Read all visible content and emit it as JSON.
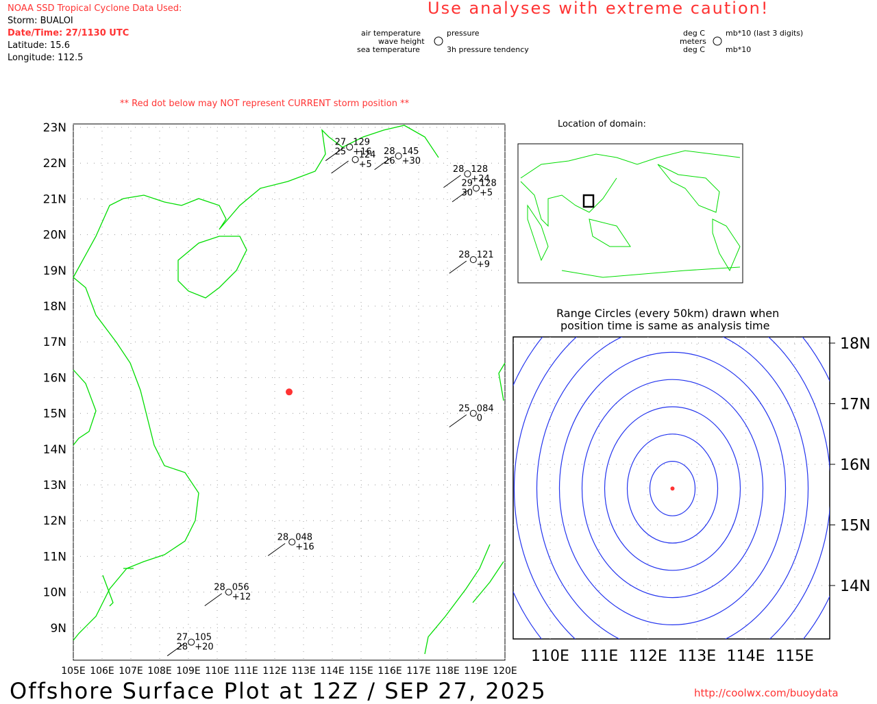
{
  "header": {
    "source": "NOAA SSD Tropical Cyclone Data Used:",
    "storm": "Storm: BUALOI",
    "datetime": "Date/Time: 27/1130 UTC",
    "latitude": "Latitude: 15.6",
    "longitude": "Longitude: 112.5",
    "caution": "Use analyses with extreme caution!",
    "red_dot_note": "** Red dot below may NOT represent CURRENT storm position **"
  },
  "legend": {
    "air": "air temperature",
    "wave": "wave height",
    "sea": "sea temperature",
    "pressure": "pressure",
    "tendency": "3h pressure tendency",
    "u_air": "deg C",
    "u_wave": "meters",
    "u_sea": "deg C",
    "u_pressure": "mb*10 (last 3 digits)",
    "u_tendency": "mb*10"
  },
  "main_map": {
    "lon_labels": [
      "105E",
      "106E",
      "107E",
      "108E",
      "109E",
      "110E",
      "111E",
      "112E",
      "113E",
      "114E",
      "115E",
      "116E",
      "117E",
      "118E",
      "119E",
      "120E"
    ],
    "lat_labels": [
      "23N",
      "22N",
      "21N",
      "20N",
      "19N",
      "18N",
      "17N",
      "16N",
      "15N",
      "14N",
      "13N",
      "12N",
      "11N",
      "10N",
      "9N"
    ],
    "storm": {
      "lon": 112.5,
      "lat": 15.6,
      "color": "#ff3333"
    },
    "stations": [
      {
        "lon": 114.6,
        "lat": 22.45,
        "air": "27",
        "pres": "129",
        "sea": "25",
        "tend": "+16"
      },
      {
        "lon": 114.8,
        "lat": 22.1,
        "air": "",
        "pres": "124",
        "sea": "",
        "tend": "+5"
      },
      {
        "lon": 116.3,
        "lat": 22.2,
        "air": "28",
        "pres": "145",
        "sea": "26",
        "tend": "+30"
      },
      {
        "lon": 118.7,
        "lat": 21.7,
        "air": "28",
        "pres": "128",
        "sea": "",
        "tend": "+24"
      },
      {
        "lon": 119.0,
        "lat": 21.3,
        "air": "29",
        "pres": "128",
        "sea": "30",
        "tend": "+5"
      },
      {
        "lon": 118.9,
        "lat": 19.3,
        "air": "28",
        "pres": "121",
        "sea": "",
        "tend": "+9"
      },
      {
        "lon": 118.9,
        "lat": 15.0,
        "air": "25",
        "pres": "084",
        "sea": "",
        "tend": "0"
      },
      {
        "lon": 112.6,
        "lat": 11.4,
        "air": "28",
        "pres": "048",
        "sea": "",
        "tend": "+16"
      },
      {
        "lon": 110.4,
        "lat": 10.0,
        "air": "28",
        "pres": "056",
        "sea": "",
        "tend": "+12"
      },
      {
        "lon": 109.1,
        "lat": 8.6,
        "air": "27",
        "pres": "105",
        "sea": "28",
        "tend": "+20"
      }
    ]
  },
  "inset": {
    "title": "Location of domain:"
  },
  "range": {
    "title1": "Range Circles (every 50km) drawn when",
    "title2": "position time is same as analysis time",
    "lon_labels": [
      "110E",
      "111E",
      "112E",
      "113E",
      "114E",
      "115E"
    ],
    "lat_labels": [
      "18N",
      "17N",
      "16N",
      "15N",
      "14N"
    ],
    "circles": 9
  },
  "footer": {
    "title": "Offshore Surface Plot at 12Z / SEP 27, 2025",
    "url": "http://coolwx.com/buoydata"
  }
}
